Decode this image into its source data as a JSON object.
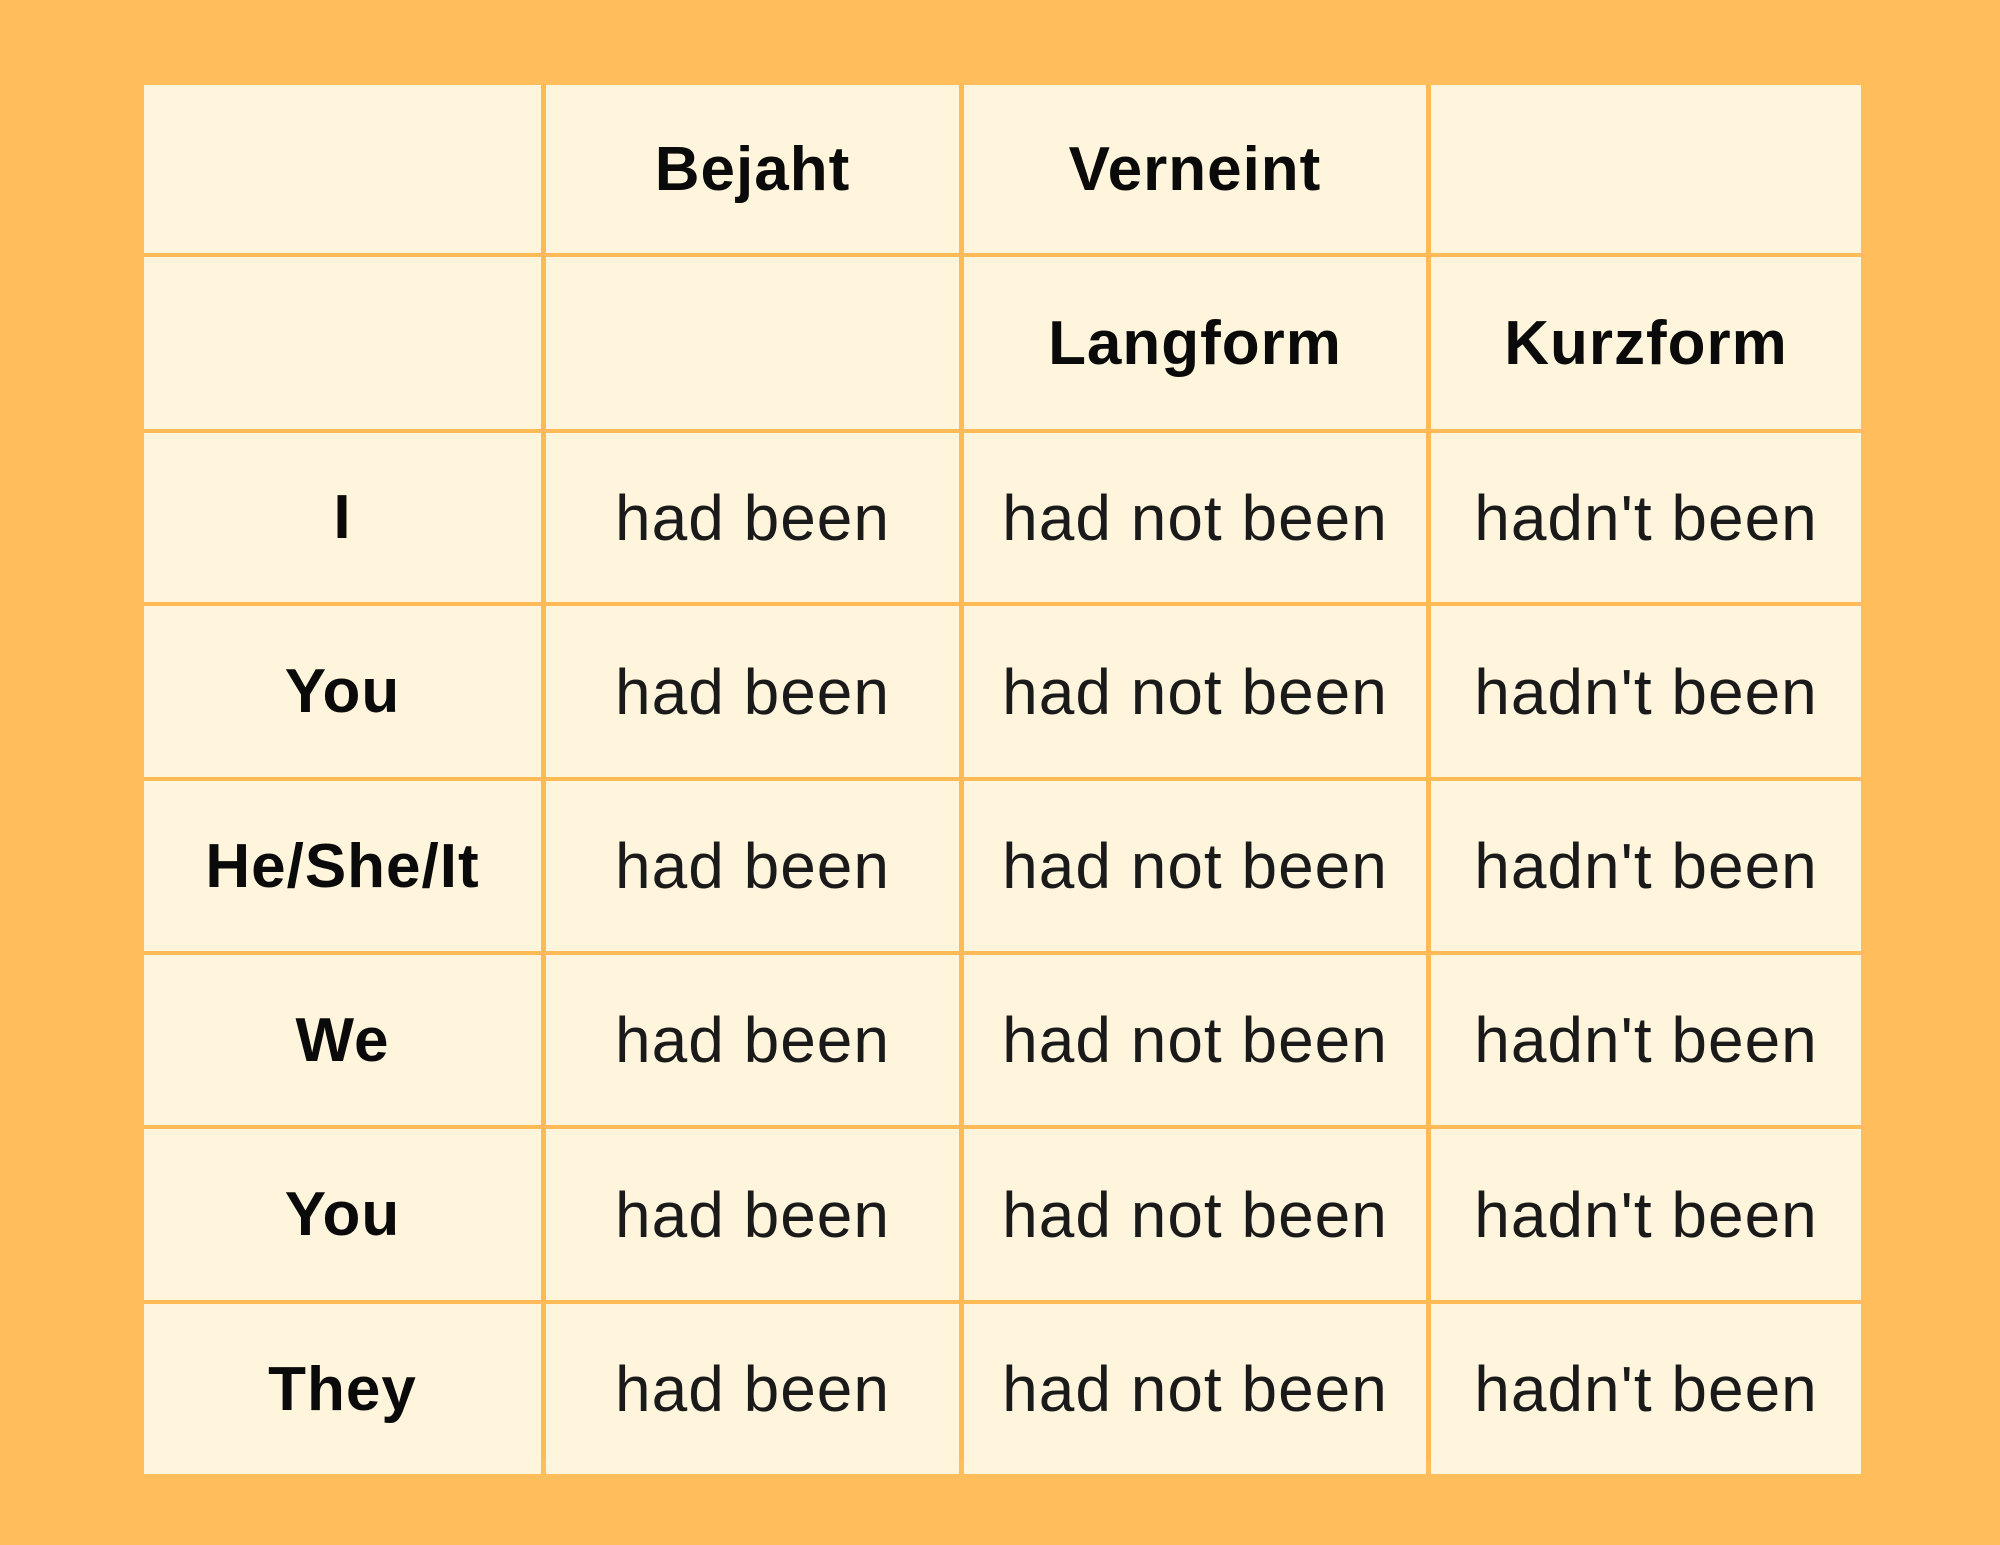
{
  "colors": {
    "background": "#FFBE5B",
    "cell": "#FFF5DC",
    "grid": "#FDBA55",
    "text": "#111111"
  },
  "header_row_1": [
    "",
    "Bejaht",
    "Verneint",
    ""
  ],
  "header_row_2": [
    "",
    "",
    "Langform",
    "Kurzform"
  ],
  "rows": [
    {
      "pronoun": "I",
      "bejaht": "had been",
      "langform": "had not been",
      "kurzform": "hadn't been"
    },
    {
      "pronoun": "You",
      "bejaht": "had been",
      "langform": "had not been",
      "kurzform": "hadn't been"
    },
    {
      "pronoun": "He/She/It",
      "bejaht": "had been",
      "langform": "had not been",
      "kurzform": "hadn't been"
    },
    {
      "pronoun": "We",
      "bejaht": "had been",
      "langform": "had not been",
      "kurzform": "hadn't been"
    },
    {
      "pronoun": "You",
      "bejaht": "had been",
      "langform": "had not been",
      "kurzform": "hadn't been"
    },
    {
      "pronoun": "They",
      "bejaht": "had been",
      "langform": "had not been",
      "kurzform": "hadn't been"
    }
  ]
}
